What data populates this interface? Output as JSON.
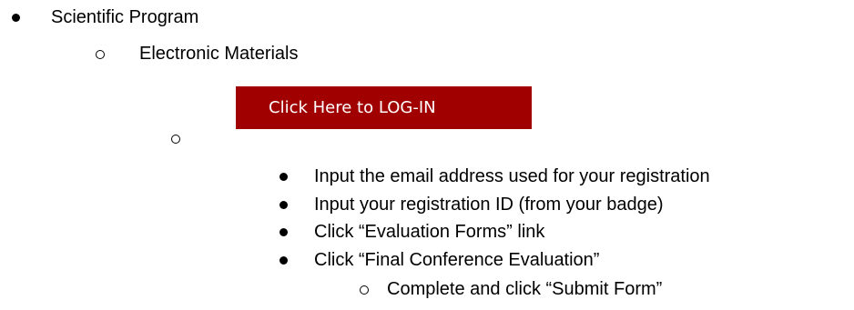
{
  "list": {
    "item1": "Scientific Program",
    "item1_sub": "Electronic Materials",
    "login_button": "Click Here to LOG-IN",
    "steps": [
      "Input the email address used for your registration",
      "Input your registration ID (from your badge)",
      "Click “Evaluation Forms” link",
      "Click “Final Conference Evaluation”"
    ],
    "final_substep": "Complete and click “Submit Form”"
  }
}
